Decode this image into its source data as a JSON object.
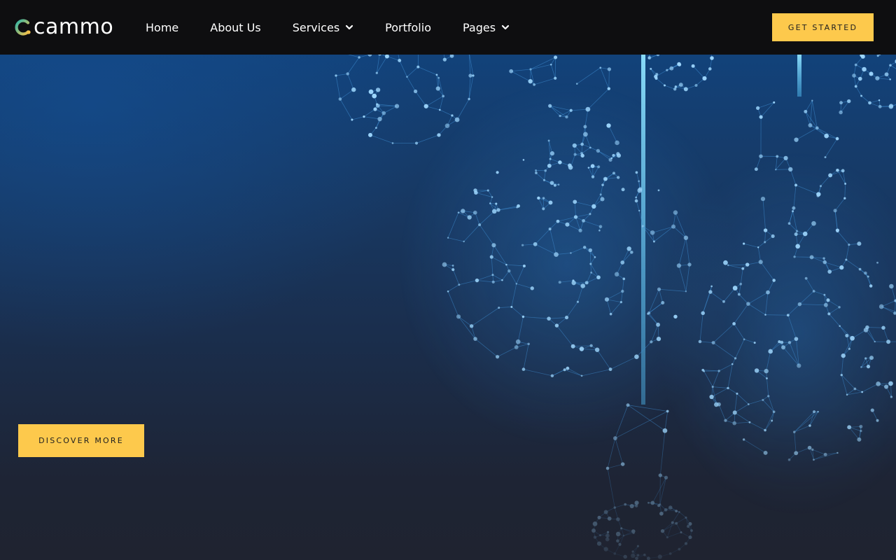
{
  "brand": {
    "name": "cammo",
    "logo_icon": "c-ring-logo-icon",
    "colors": {
      "accent": "#fdc94c",
      "logo_ring_start": "#2fb6a8",
      "logo_ring_end": "#f2c04a",
      "header_bg": "#0e0e10",
      "hero_top": "#12427a",
      "hero_bottom": "#1f2330"
    }
  },
  "nav": {
    "items": [
      {
        "label": "Home",
        "has_dropdown": false
      },
      {
        "label": "About Us",
        "has_dropdown": false
      },
      {
        "label": "Services",
        "has_dropdown": true
      },
      {
        "label": "Portfolio",
        "has_dropdown": false
      },
      {
        "label": "Pages",
        "has_dropdown": true
      }
    ],
    "dropdown_icon": "chevron-down-icon"
  },
  "header": {
    "cta_label": "GET STARTED"
  },
  "hero": {
    "cta_label": "DISCOVER MORE",
    "background_art": "network-lightbulbs-illustration"
  }
}
